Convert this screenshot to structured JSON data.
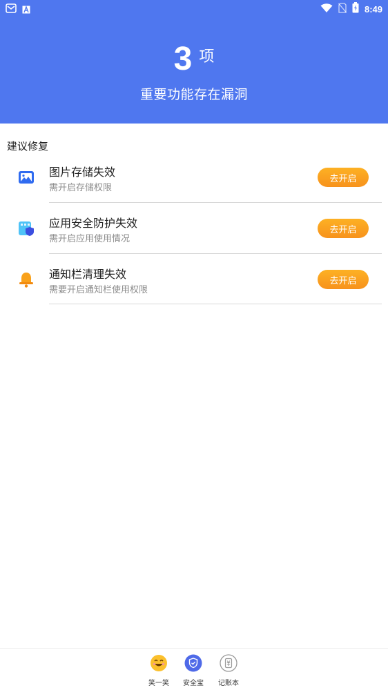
{
  "status_bar": {
    "time": "8:49"
  },
  "summary": {
    "count": "3",
    "unit": "项",
    "headline": "重要功能存在漏洞"
  },
  "section_title": "建议修复",
  "items": [
    {
      "title": "图片存储失效",
      "desc": "需开启存储权限",
      "button": "去开启",
      "icon": "image-icon"
    },
    {
      "title": "应用安全防护失效",
      "desc": "需开启应用使用情况",
      "button": "去开启",
      "icon": "app-shield-icon"
    },
    {
      "title": "通知栏清理失效",
      "desc": "需要开启通知栏使用权限",
      "button": "去开启",
      "icon": "bell-icon"
    }
  ],
  "nav": [
    {
      "label": "笑一笑",
      "icon": "smile-emoji-icon"
    },
    {
      "label": "安全宝",
      "icon": "shield-icon"
    },
    {
      "label": "记账本",
      "icon": "ledger-icon"
    }
  ],
  "colors": {
    "header_bg": "#4f77ef",
    "button_orange": "#f7921c",
    "nav_active": "#4f6ae8"
  }
}
